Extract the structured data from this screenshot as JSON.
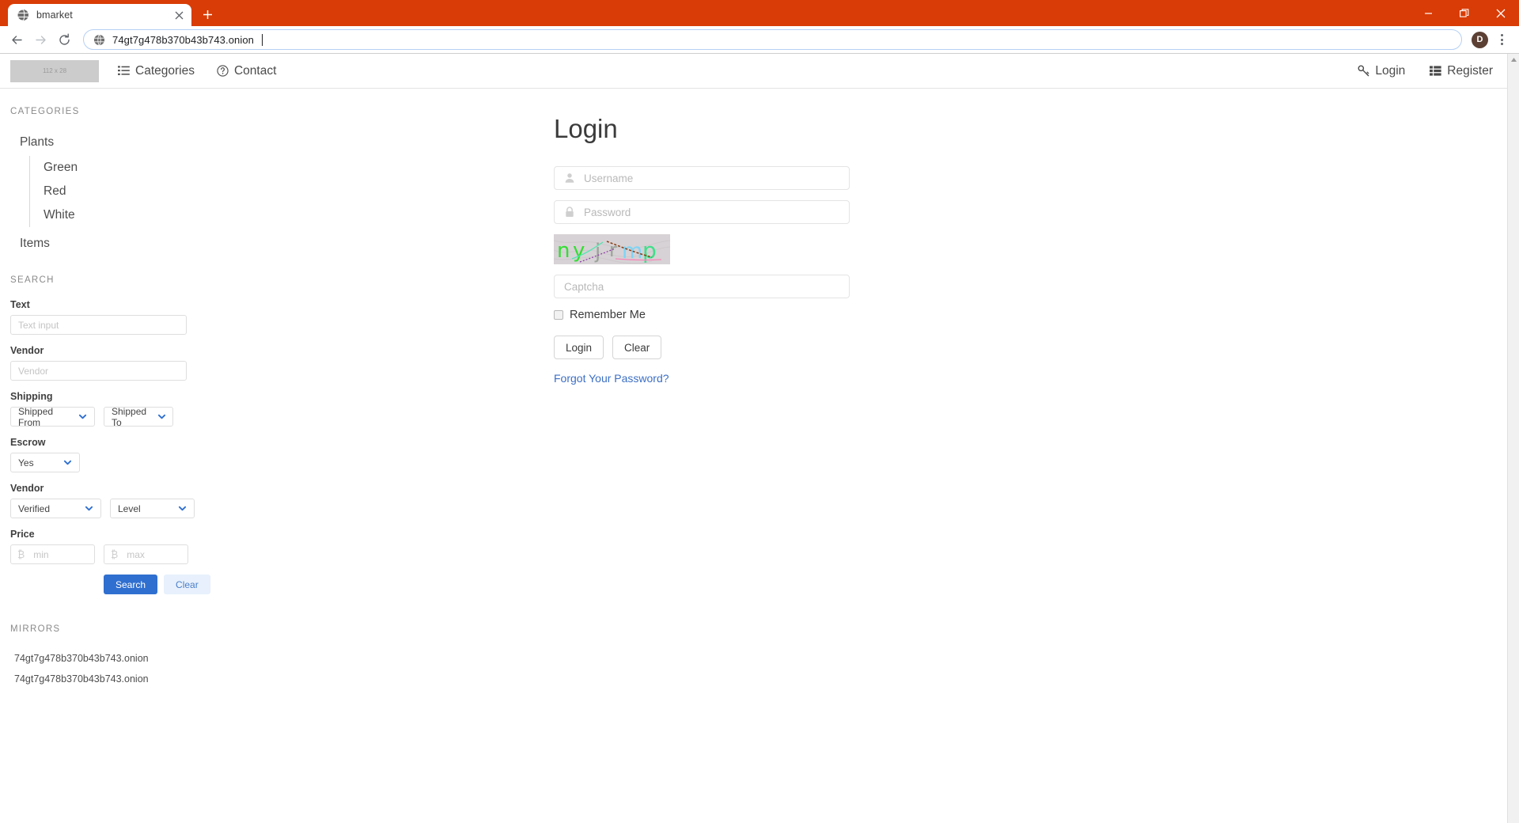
{
  "browser": {
    "tab": {
      "title": "bmarket",
      "favicon_icon": "globe-icon",
      "close_icon": "close-icon"
    },
    "new_tab_label": "+",
    "window_controls": {
      "minimize": "minimize-icon",
      "restore": "restore-icon",
      "close": "close-icon"
    },
    "toolbar": {
      "back_icon": "arrow-left-icon",
      "forward_icon": "arrow-right-icon",
      "reload_icon": "reload-icon",
      "site_icon": "globe-icon",
      "url": "74gt7g478b370b43b743.onion",
      "profile_initial": "D",
      "menu_icon": "three-dots-icon"
    },
    "titlebar_color": "#d93c06"
  },
  "site": {
    "navbar": {
      "logo_placeholder_text": "112 x 28",
      "links": [
        {
          "label": "Categories",
          "icon": "list-icon"
        },
        {
          "label": "Contact",
          "icon": "question-circle-icon"
        }
      ],
      "right_links": [
        {
          "label": "Login",
          "icon": "key-icon"
        },
        {
          "label": "Register",
          "icon": "table-list-icon"
        }
      ]
    },
    "sidebar": {
      "categories_heading": "CATEGORIES",
      "categories": [
        {
          "label": "Plants",
          "children": [
            "Green",
            "Red",
            "White"
          ]
        },
        {
          "label": "Items",
          "children": []
        }
      ],
      "search_heading": "SEARCH",
      "fields": {
        "text_label": "Text",
        "text_placeholder": "Text input",
        "text_value": "",
        "vendor_label": "Vendor",
        "vendor_placeholder": "Vendor",
        "vendor_value": "",
        "shipping_label": "Shipping",
        "shipped_from_value": "Shipped From",
        "shipped_to_value": "Shipped To",
        "escrow_label": "Escrow",
        "escrow_value": "Yes",
        "vendor2_label": "Vendor",
        "verified_value": "Verified",
        "level_value": "Level",
        "price_label": "Price",
        "price_min_placeholder": "min",
        "price_max_placeholder": "max",
        "currency_symbol": "₿",
        "search_button": "Search",
        "clear_button": "Clear"
      },
      "mirrors_heading": "MIRRORS",
      "mirrors": [
        "74gt7g478b370b43b743.onion",
        "74gt7g478b370b43b743.onion"
      ]
    },
    "login": {
      "title": "Login",
      "username_placeholder": "Username",
      "username_value": "",
      "username_icon": "user-icon",
      "password_placeholder": "Password",
      "password_value": "",
      "password_icon": "lock-icon",
      "captcha_text": "nyjrmp",
      "captcha_letters": [
        {
          "char": "n",
          "color": "#33dd33"
        },
        {
          "char": "y",
          "color": "#33dd33"
        },
        {
          "char": "j",
          "color": "#9aa399"
        },
        {
          "char": "r",
          "color": "#9aa399"
        },
        {
          "char": "m",
          "color": "#7fd4f5"
        },
        {
          "char": "p",
          "color": "#3fe08a"
        }
      ],
      "captcha_placeholder": "Captcha",
      "captcha_value": "",
      "remember_label": "Remember Me",
      "remember_checked": false,
      "login_button": "Login",
      "clear_button": "Clear",
      "forgot_link": "Forgot Your Password?",
      "link_color": "#3c6fc4"
    }
  }
}
